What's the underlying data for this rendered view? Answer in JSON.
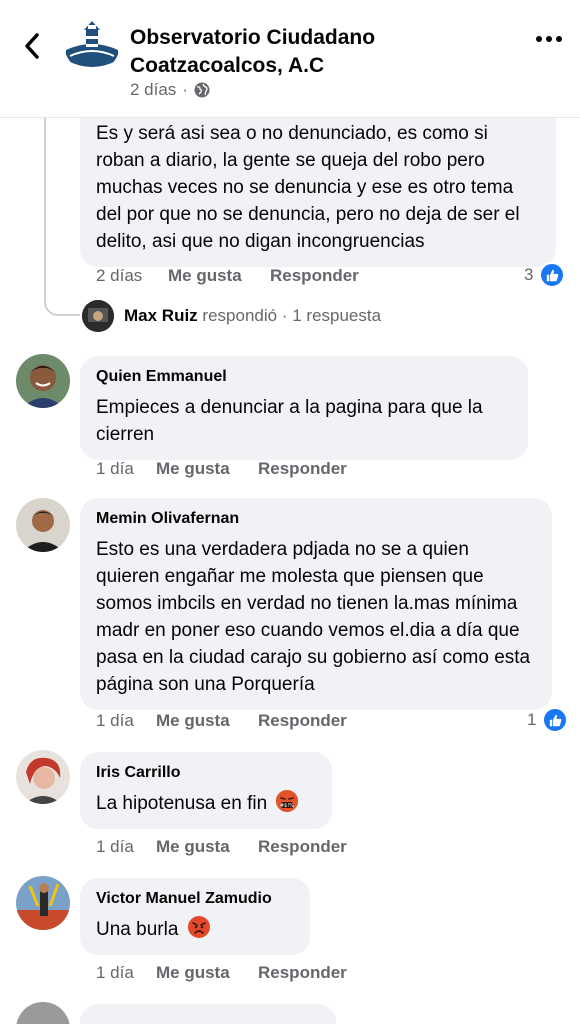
{
  "header": {
    "page_name": "Observatorio Ciudadano Coatzacoalcos, A.C",
    "meta_time": "2 días",
    "meta_separator": "·"
  },
  "comments": [
    {
      "text": "Es y será asi sea o no denunciado,  es como si roban a diario, la gente se queja del robo pero muchas veces no se denuncia y ese es otro tema del por que no se denuncia, pero no deja de ser el delito, asi que no digan incongruencias",
      "time": "2 días",
      "like_label": "Me gusta",
      "reply_label": "Responder",
      "reactions": "3"
    },
    {
      "author": "Quien Emmanuel",
      "text": "Empieces a denunciar a la pagina para que la cierren",
      "time": "1 día",
      "like_label": "Me gusta",
      "reply_label": "Responder"
    },
    {
      "author": "Memin Olivafernan",
      "text": "Esto es  una verdadera  pdjada no se a quien quieren engañar  me molesta que piensen  que somos imbcils  en verdad no tienen la.mas mínima madr en poner eso cuando vemos el.dia a día que pasa en la ciudad carajo  su gobierno así como esta página son una Porquería",
      "time": "1 día",
      "like_label": "Me gusta",
      "reply_label": "Responder",
      "reactions": "1"
    },
    {
      "author": "Iris Carrillo",
      "text": "La hipotenusa en fin",
      "time": "1 día",
      "like_label": "Me gusta",
      "reply_label": "Responder",
      "emoji": "face-with-symbols-on-mouth"
    },
    {
      "author": "Victor Manuel Zamudio",
      "text": "Una burla",
      "time": "1 día",
      "like_label": "Me gusta",
      "reply_label": "Responder",
      "emoji": "angry-face"
    }
  ],
  "reply_summary": {
    "author": "Max Ruiz",
    "action": "respondió",
    "separator": "·",
    "count": "1 respuesta"
  },
  "colors": {
    "accent": "#1877f2",
    "bubble": "#f0f2f5",
    "muted": "#65676b"
  }
}
